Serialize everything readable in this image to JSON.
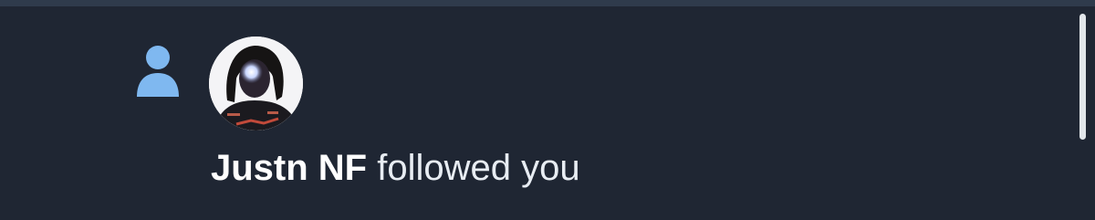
{
  "notification": {
    "type_icon": "person-icon",
    "user_name": "Justn NF",
    "action_text": "followed you"
  },
  "colors": {
    "background": "#1f2633",
    "icon_accent": "#7fb8f0",
    "text": "#e8edf3"
  }
}
